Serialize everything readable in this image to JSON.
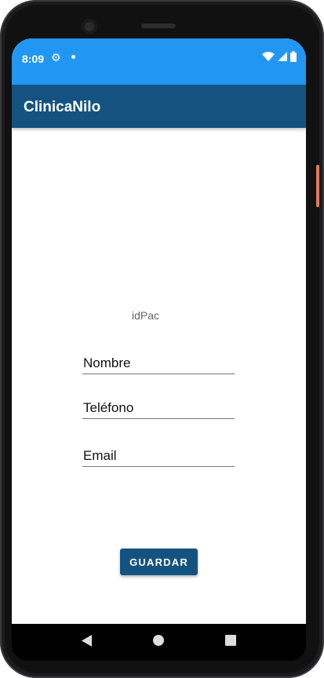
{
  "status_bar": {
    "time": "8:09",
    "background": "#2196f3"
  },
  "app_bar": {
    "title": "ClinicaNilo",
    "background": "#145380"
  },
  "form": {
    "id_label": "idPac",
    "nombre_placeholder": "Nombre",
    "telefono_placeholder": "Teléfono",
    "email_placeholder": "Email",
    "save_label": "GUARDAR"
  },
  "nav_bar": {
    "icons": [
      "back-icon",
      "home-icon",
      "recents-icon"
    ]
  }
}
